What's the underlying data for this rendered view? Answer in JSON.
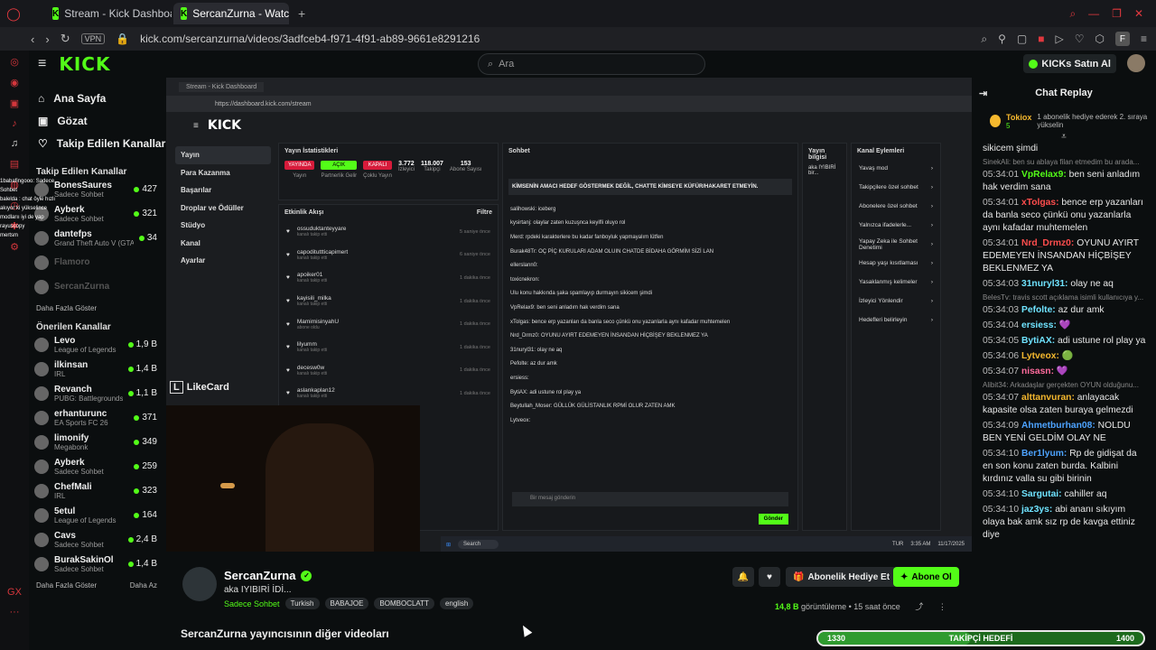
{
  "browser": {
    "tabs": [
      {
        "label": "Stream - Kick Dashboard"
      },
      {
        "label": "SercanZurna - Watch"
      }
    ],
    "url": "kick.com/sercanzurna/videos/3adfceb4-f971-4f91-ab89-9661e8291216",
    "vpn": "VPN",
    "profile": "F"
  },
  "header": {
    "logo": "KICK",
    "search_placeholder": "Ara",
    "kicks_button": "KICKs Satın Al"
  },
  "nav": {
    "home": "Ana Sayfa",
    "browse": "Gözat",
    "following": "Takip Edilen Kanallar"
  },
  "followed": {
    "title": "Takip Edilen Kanallar",
    "items": [
      {
        "name": "BonesSaures",
        "cat": "Sadece Sohbet",
        "viewers": "427"
      },
      {
        "name": "Ayberk",
        "cat": "Sadece Sohbet",
        "viewers": "321"
      },
      {
        "name": "dantefps",
        "cat": "Grand Theft Auto V (GTA)",
        "viewers": "34"
      },
      {
        "name": "Flamoro",
        "cat": "",
        "viewers": ""
      },
      {
        "name": "SercanZurna",
        "cat": "",
        "viewers": ""
      }
    ],
    "show_more": "Daha Fazla Göster"
  },
  "recommended": {
    "title": "Önerilen Kanallar",
    "items": [
      {
        "name": "Levo",
        "cat": "League of Legends",
        "viewers": "1,9 B"
      },
      {
        "name": "ilkinsan",
        "cat": "IRL",
        "viewers": "1,4 B"
      },
      {
        "name": "Revanch",
        "cat": "PUBG: Battlegrounds",
        "viewers": "1,1 B"
      },
      {
        "name": "erhanturunc",
        "cat": "EA Sports FC 26",
        "viewers": "371"
      },
      {
        "name": "limonify",
        "cat": "Megabonk",
        "viewers": "349"
      },
      {
        "name": "Ayberk",
        "cat": "Sadece Sohbet",
        "viewers": "259"
      },
      {
        "name": "ChefMali",
        "cat": "IRL",
        "viewers": "323"
      },
      {
        "name": "5etul",
        "cat": "League of Legends",
        "viewers": "164"
      },
      {
        "name": "Cavs",
        "cat": "Sadece Sohbet",
        "viewers": "2,4 B"
      },
      {
        "name": "BurakSakinOl",
        "cat": "Sadece Sohbet",
        "viewers": "1,4 B"
      }
    ],
    "show_more": "Daha Fazla Göster",
    "show_less": "Daha Az"
  },
  "video": {
    "tab": "Stream - Kick Dashboard",
    "inner_url": "https://dashboard.kick.com/stream",
    "logo": "KICK",
    "menu": [
      "Yayın",
      "Para Kazanma",
      "Başarılar",
      "Droplar ve Ödüller",
      "Stüdyo",
      "Kanal",
      "Ayarlar"
    ],
    "stats_title": "Yayın İstatistikleri",
    "stats": [
      {
        "top": "YAYINDA",
        "label": "Yayın"
      },
      {
        "top": "AÇIK",
        "label": "Partnerlik Gelir"
      },
      {
        "top": "KAPALI",
        "label": "Çoklu Yayın"
      },
      {
        "top": "3.772",
        "label": "İzleyici"
      },
      {
        "top": "118.007",
        "label": "Takipçi"
      },
      {
        "top": "153",
        "label": "Abone Sayısı"
      }
    ],
    "activity_title": "Etkinlik Akışı",
    "activity_filter": "Filtre",
    "activity": [
      {
        "user": "ossuduktanteyyare",
        "sub": "kanalı takip etti",
        "ago": "5 saniye önce"
      },
      {
        "user": "capodituttticapimert",
        "sub": "kanalı takip etti",
        "ago": "6 saniye önce"
      },
      {
        "user": "apoiker01",
        "sub": "kanalı takip etti",
        "ago": "1 dakika önce"
      },
      {
        "user": "kayisili_milka",
        "sub": "kanalı takip etti",
        "ago": "1 dakika önce"
      },
      {
        "user": "MamimisinyahU",
        "sub": "abone oldu",
        "ago": "1 dakika önce"
      },
      {
        "user": "lilyumm",
        "sub": "kanalı takip etti",
        "ago": "1 dakika önce"
      },
      {
        "user": "decesw0w",
        "sub": "kanalı takip etti",
        "ago": "1 dakika önce"
      },
      {
        "user": "aslankaplan12",
        "sub": "kanalı takip etti",
        "ago": "1 dakika önce"
      }
    ],
    "chat_title": "Sohbet",
    "pinned": "KİMSENİN AMACI HEDEF GÖSTERMEK DEĞİL, CHATTE KİMSEYE KÜFÜR/HAKARET ETMEYİN.",
    "chat_lines": [
      "salihowski: iceberg",
      "kysirtanj: olaylar zaten kuzuşnca keyifli oluyo rol",
      "Merd: rpdeki karakterlere bu kadar fanboyluk yapmayalım lütfen",
      "Burak48Tr: OÇ PİÇ KURULARI ADAM OLUIN CHATDE BİDAHA GÖRMİM SİZİ LAN",
      "ellerslann0:",
      "toxicnekron:",
      "Ulu konu hakkında şaka spamlayıp durmayın sikicem şimdi",
      "VpRelax9: ben seni anladım hak verdim sana",
      "xTolgas: bence erp yazanları da banla seco çünkü onu yazanlarla aynı kafadar muhtemelen",
      "Nrd_Drmz0: OYUNU AYIRT EDEMEYEN İNSANDAN HİÇBİŞEY BEKLENMEZ YA",
      "31nuryl31: olay ne aq",
      "Pefolte: az dur amk",
      "ersiess:",
      "BytiAX: adi ustune rol play ya",
      "Beytullah_Moser: GÜLLÜK GÜLİSTANLIK RPMİ OLUR ZATEN AMK",
      "Lytveox:"
    ],
    "chat_input": "Bir mesaj gönderin",
    "send": "Gönder",
    "info_title": "Yayın bilgisi",
    "info_text": "aka IYIBIRİ bir...",
    "actions_title": "Kanal Eylemleri",
    "actions": [
      "Yavaş mod",
      "Takipçilere özel sohbet",
      "Abonelere özel sohbet",
      "Yalnızca ifadelerle...",
      "Yapay Zeka ile Sohbet Denetimi",
      "Hesap yaşı kısıtlaması",
      "Yasaklanmış kelimeler",
      "İzleyici Yönlendir",
      "Hedefleri belirleyin"
    ],
    "taskbar_search": "Search",
    "clock": "3:35 AM",
    "date": "11/17/2025",
    "lang": "TUR",
    "likecard": "LikeCard"
  },
  "streamer": {
    "name": "SercanZurna",
    "title": "aka IYIBIRİ İDİ...",
    "category": "Sadece Sohbet",
    "tags": [
      "Turkish",
      "BABAJOE",
      "BOMBOCLATT",
      "english"
    ],
    "gift_button": "Abonelik Hediye Et",
    "subscribe_button": "Abone Ol",
    "views": "14,8 B",
    "views_label": "görüntüleme",
    "time_ago": "15 saat önce",
    "other_videos": "SercanZurna yayıncısının diğer videoları"
  },
  "chat": {
    "title": "Chat Replay",
    "pinned_user": "Tokiox",
    "pinned_count": "5",
    "pinned_text": "1 abonelik hediye ederek 2. sıraya yükselin",
    "messages": [
      {
        "time": "",
        "user": "",
        "text": "sikicem şimdi",
        "color": "#e8e8e8"
      },
      {
        "sys": "SinekAli: ben su ablaya filan etmedim bu arada..."
      },
      {
        "time": "05:34:01",
        "user": "VpRelax9:",
        "text": "ben seni anladım hak verdim sana",
        "color": "#53fc18"
      },
      {
        "time": "05:34:01",
        "user": "xTolgas:",
        "text": "bence erp yazanları da banla seco çünkü onu yazanlarla aynı kafadar muhtemelen",
        "color": "#ff4d4d"
      },
      {
        "time": "05:34:01",
        "user": "Nrd_Drmz0:",
        "text": "OYUNU AYIRT EDEMEYEN İNSANDAN HİÇBİŞEY BEKLENMEZ YA",
        "color": "#ff4d4d"
      },
      {
        "time": "05:34:03",
        "user": "31nuryl31:",
        "text": "olay ne aq",
        "color": "#6fe3ff"
      },
      {
        "sys": "BelesTv: travis scott açıklama isimli kullanıcıya y..."
      },
      {
        "time": "05:34:03",
        "user": "Pefolte:",
        "text": "az dur amk",
        "color": "#6fe3ff"
      },
      {
        "time": "05:34:04",
        "user": "ersiess:",
        "text": "💜",
        "color": "#6fe3ff"
      },
      {
        "time": "05:34:05",
        "user": "BytiAX:",
        "text": "adi ustune rol play ya",
        "color": "#6fe3ff"
      },
      {
        "time": "05:34:06",
        "user": "Lytveox:",
        "text": "🟢",
        "color": "#f5b82e"
      },
      {
        "time": "05:34:07",
        "user": "nisasn:",
        "text": "💜",
        "color": "#ff6b9d"
      },
      {
        "sys": "Alibit34: Arkadaşlar gerçekten OYUN olduğunu..."
      },
      {
        "time": "05:34:07",
        "user": "alttanvuran:",
        "text": "anlayacak kapasite olsa zaten buraya gelmezdi",
        "color": "#f5b82e"
      },
      {
        "time": "05:34:09",
        "user": "Ahmetburhan08:",
        "text": "NOLDU BEN YENİ GELDİM OLAY NE",
        "color": "#4da3ff"
      },
      {
        "time": "05:34:10",
        "user": "Ber1lyum:",
        "text": "Rp de gidişat da en son konu zaten burda. Kalbini kırdınız valla su gibi birinin",
        "color": "#4da3ff"
      },
      {
        "time": "05:34:10",
        "user": "Sargutai:",
        "text": "cahiller aq",
        "color": "#6fe3ff"
      },
      {
        "time": "05:34:10",
        "user": "jaz3ys:",
        "text": "abi ananı sıkıyım olaya bak amk sız rp de kavga ettiniz diye",
        "color": "#6fe3ff"
      }
    ]
  },
  "goal": {
    "start": "1330",
    "label": "TAKİPÇİ HEDEFİ",
    "end": "1400",
    "progress": 0.47
  },
  "overlay_chat": [
    "1babafingooo: Sadece Sohbet",
    "balelda : chat öyle hızlı akıyor ki yükselince modlarıı iyi de yap",
    "rayuscopy",
    "mertsm"
  ],
  "colors": {
    "accent": "#53fc18",
    "bg": "#0b0e0f"
  }
}
